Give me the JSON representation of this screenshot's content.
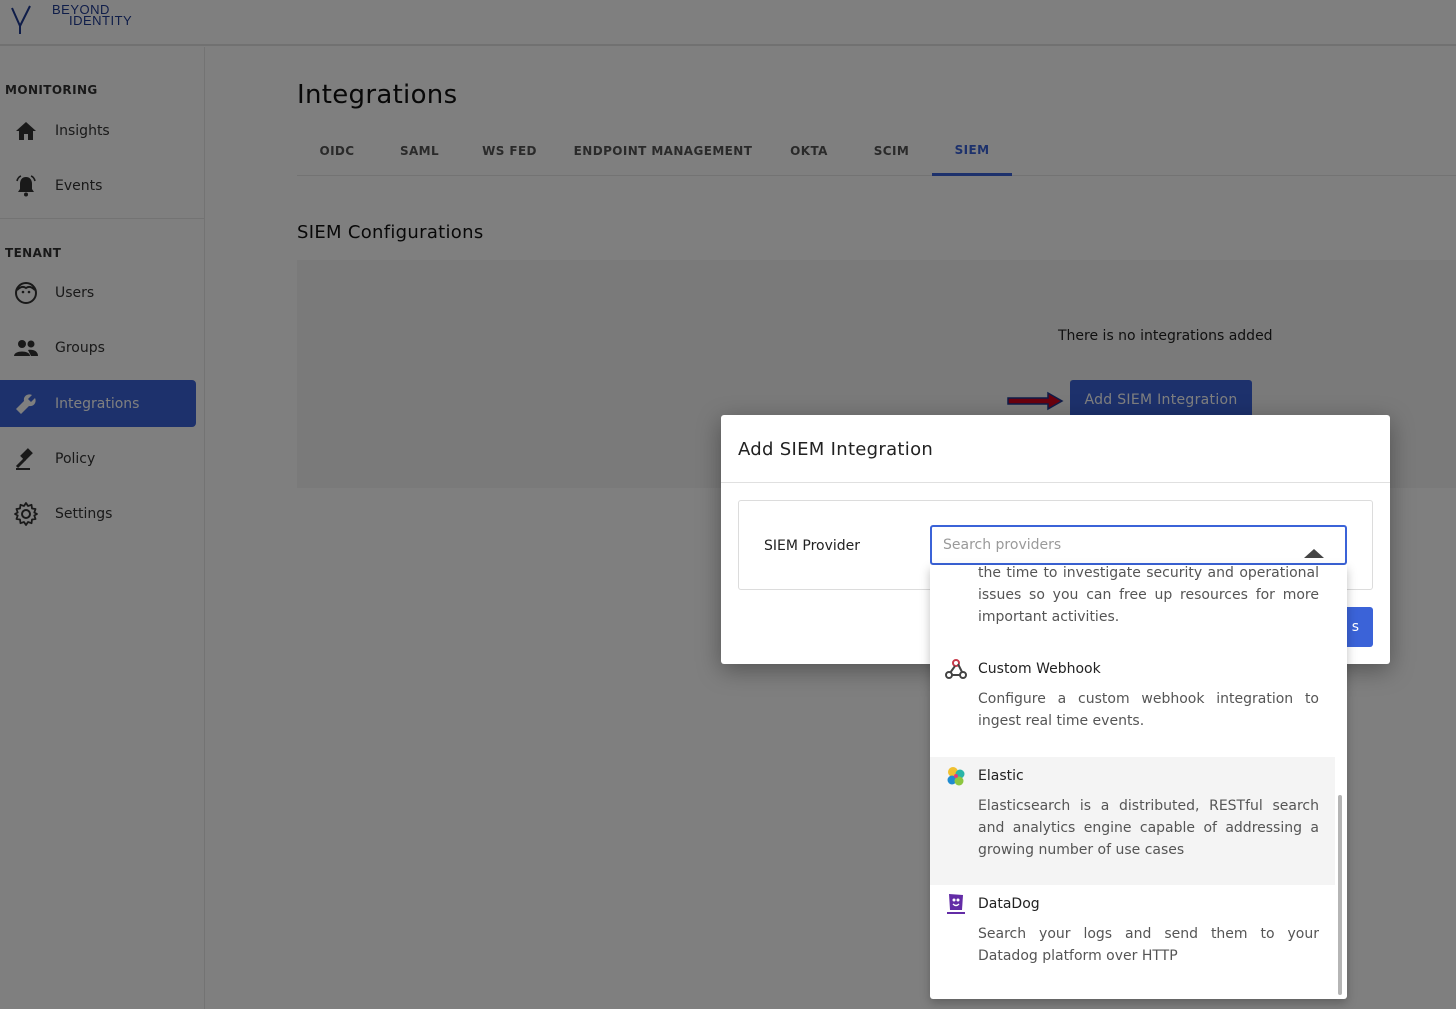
{
  "brand": {
    "line1": "BEYOND",
    "line2": "IDENTITY"
  },
  "sidebar": {
    "monitoring_label": "MONITORING",
    "tenant_label": "TENANT",
    "items": [
      {
        "label": "Insights",
        "icon": "home-icon"
      },
      {
        "label": "Events",
        "icon": "bell-icon"
      },
      {
        "label": "Users",
        "icon": "user-face-icon"
      },
      {
        "label": "Groups",
        "icon": "group-icon"
      },
      {
        "label": "Integrations",
        "icon": "wrench-icon",
        "active": true
      },
      {
        "label": "Policy",
        "icon": "gavel-icon"
      },
      {
        "label": "Settings",
        "icon": "gear-icon"
      }
    ]
  },
  "main": {
    "title": "Integrations",
    "tabs": [
      {
        "label": "OIDC"
      },
      {
        "label": "SAML"
      },
      {
        "label": "WS FED"
      },
      {
        "label": "ENDPOINT MANAGEMENT"
      },
      {
        "label": "OKTA"
      },
      {
        "label": "SCIM"
      },
      {
        "label": "SIEM",
        "active": true
      }
    ],
    "section_title": "SIEM Configurations",
    "empty_message": "There is no integrations added",
    "add_button": "Add SIEM Integration"
  },
  "modal": {
    "title": "Add SIEM Integration",
    "field_label": "SIEM Provider",
    "search_placeholder": "Search providers",
    "save_partial": "s",
    "partial_description": "the time to investigate security and operational issues so you can free up resources for more important activities.",
    "options": [
      {
        "name": "Custom Webhook",
        "icon": "webhook-icon",
        "description": "Configure a custom webhook integration to ingest real time events."
      },
      {
        "name": "Elastic",
        "icon": "elastic-logo-icon",
        "description": "Elasticsearch is a distributed, RESTful search and analytics engine capable of addressing a growing number of use cases",
        "hover": true
      },
      {
        "name": "DataDog",
        "icon": "datadog-logo-icon",
        "description": "Search your logs and send them to your Datadog platform over HTTP"
      }
    ]
  },
  "colors": {
    "accent": "#3b63d8",
    "annotation_arrow": "#d6001c"
  }
}
